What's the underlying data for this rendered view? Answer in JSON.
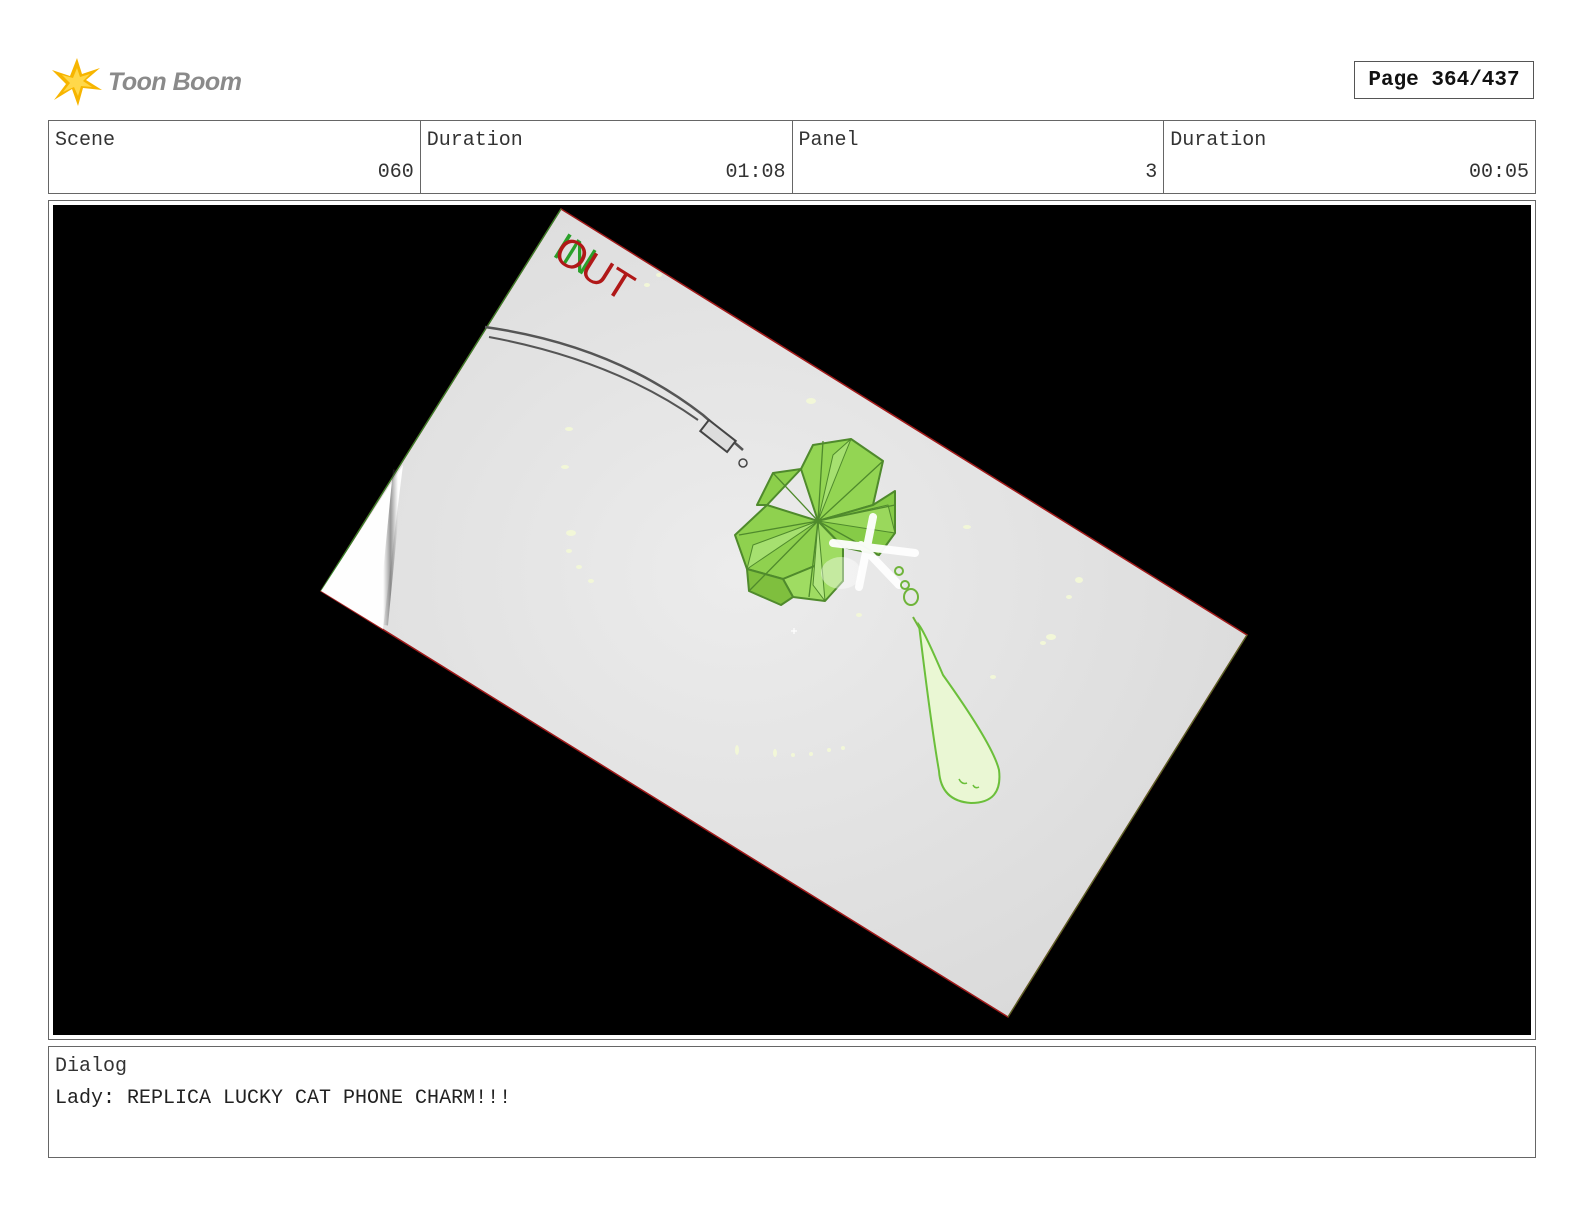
{
  "header": {
    "logo_text": "Toon Boom",
    "page_label": "Page 364/437"
  },
  "info": {
    "scene_label": "Scene",
    "scene_value": "060",
    "scene_duration_label": "Duration",
    "scene_duration_value": "01:08",
    "panel_label": "Panel",
    "panel_value": "3",
    "panel_duration_label": "Duration",
    "panel_duration_value": "00:05"
  },
  "panel": {
    "overlay_out": "OUT",
    "overlay_in": "IN"
  },
  "dialog": {
    "label": "Dialog",
    "text": "Lady: REPLICA LUCKY CAT PHONE CHARM!!!"
  },
  "colors": {
    "frame_bg": "#000000",
    "paper": "#e2e2e2",
    "clover": "#8fd14f",
    "clover_stroke": "#5f9a38",
    "out_text": "#b01818",
    "in_text": "#2aa02a",
    "logo_spark": "#f5b800"
  }
}
